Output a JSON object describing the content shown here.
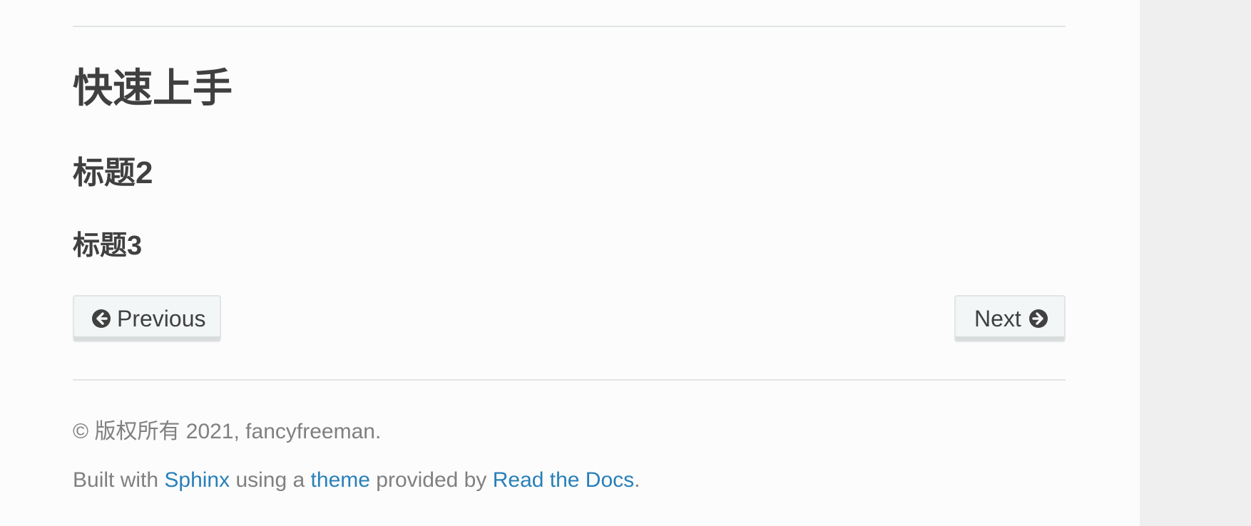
{
  "document": {
    "title": "快速上手",
    "heading2": "标题2",
    "heading3": "标题3"
  },
  "navigation": {
    "previous_label": "Previous",
    "previous_icon": "arrow-circle-left-icon",
    "next_label": "Next",
    "next_icon": "arrow-circle-right-icon"
  },
  "footer": {
    "copyright": "© 版权所有 2021, fancyfreeman.",
    "built_prefix": "Built with ",
    "sphinx_link": "Sphinx",
    "built_middle": " using a ",
    "theme_link": "theme",
    "built_suffix": " provided by ",
    "rtd_link": "Read the Docs",
    "built_end": "."
  },
  "colors": {
    "background": "#fcfcfc",
    "gutter": "#efefef",
    "text": "#404040",
    "muted_text": "#808080",
    "link": "#2980b9",
    "button_bg": "#f3f6f6",
    "rule": "#e1e4e5"
  }
}
